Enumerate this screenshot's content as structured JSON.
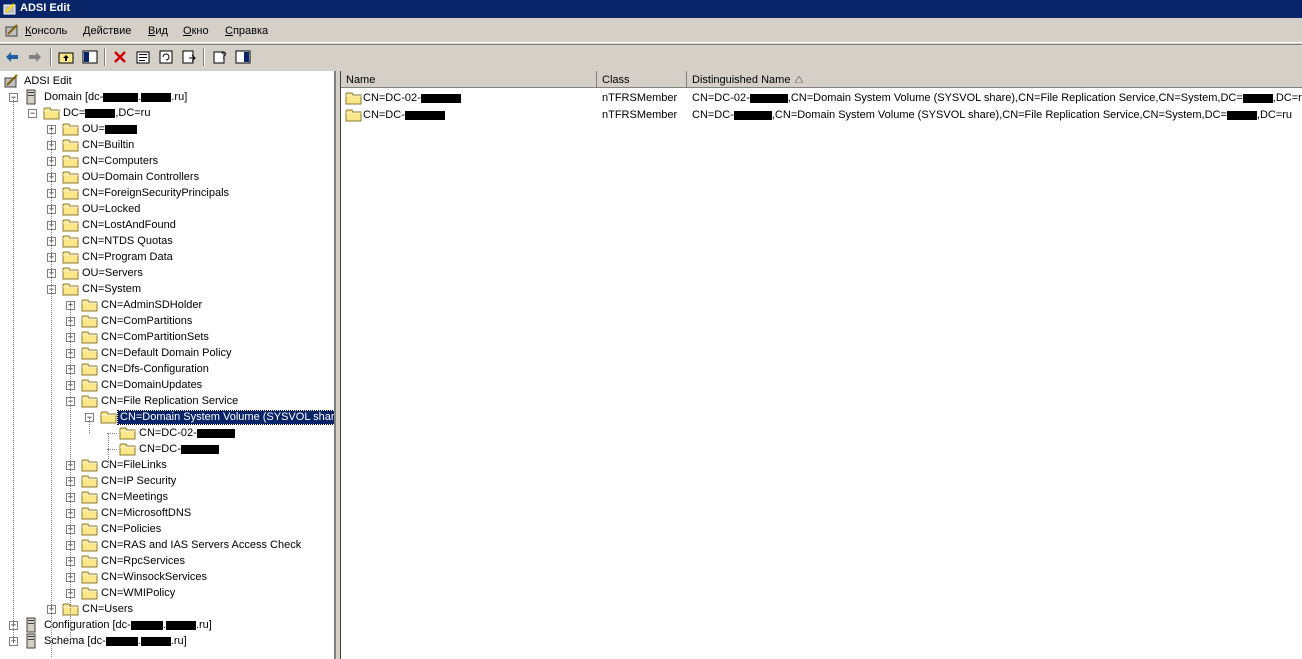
{
  "window": {
    "title": "ADSI Edit"
  },
  "menu": [
    "Консоль",
    "Действие",
    "Вид",
    "Окно",
    "Справка"
  ],
  "tree": {
    "root": "ADSI Edit",
    "domain": {
      "prefix": "Domain [dc-",
      "mid": ".",
      "suffix": ".ru]"
    },
    "dc": {
      "prefix": "DC=",
      "suffix": ",DC=ru"
    },
    "ou_redacted_prefix": "OU=",
    "level2": [
      "CN=Builtin",
      "CN=Computers",
      "OU=Domain Controllers",
      "CN=ForeignSecurityPrincipals",
      "OU=Locked",
      "CN=LostAndFound",
      "CN=NTDS Quotas",
      "CN=Program Data",
      "OU=Servers",
      "CN=System"
    ],
    "system_children_a": [
      "CN=AdminSDHolder",
      "CN=ComPartitions",
      "CN=ComPartitionSets",
      "CN=Default Domain Policy",
      "CN=Dfs-Configuration",
      "CN=DomainUpdates",
      "CN=File Replication Service"
    ],
    "selected": "CN=Domain System Volume (SYSVOL share)",
    "sysvol_children": [
      "CN=DC-02-",
      "CN=DC-"
    ],
    "system_children_b": [
      "CN=FileLinks",
      "CN=IP Security",
      "CN=Meetings",
      "CN=MicrosoftDNS",
      "CN=Policies",
      "CN=RAS and IAS Servers Access Check",
      "CN=RpcServices",
      "CN=WinsockServices",
      "CN=WMIPolicy"
    ],
    "users": "CN=Users",
    "configuration": {
      "prefix": "Configuration [dc-",
      "mid": ".",
      "suffix": ".ru]"
    },
    "schema": {
      "prefix": "Schema [dc-",
      "mid": ".",
      "suffix": ".ru]"
    }
  },
  "list": {
    "columns": [
      "Name",
      "Class",
      "Distinguished Name"
    ],
    "rows": [
      {
        "name": "CN=DC-02-",
        "class": "nTFRSMember",
        "dn_a": "CN=DC-02-",
        "dn_b": ",CN=Domain System Volume (SYSVOL share),CN=File Replication Service,CN=System,DC=",
        "dn_c": ",DC=ru"
      },
      {
        "name": "CN=DC-",
        "class": "nTFRSMember",
        "dn_a": "CN=DC-",
        "dn_b": ",CN=Domain System Volume (SYSVOL share),CN=File Replication Service,CN=System,DC=",
        "dn_c": ",DC=ru"
      }
    ]
  }
}
